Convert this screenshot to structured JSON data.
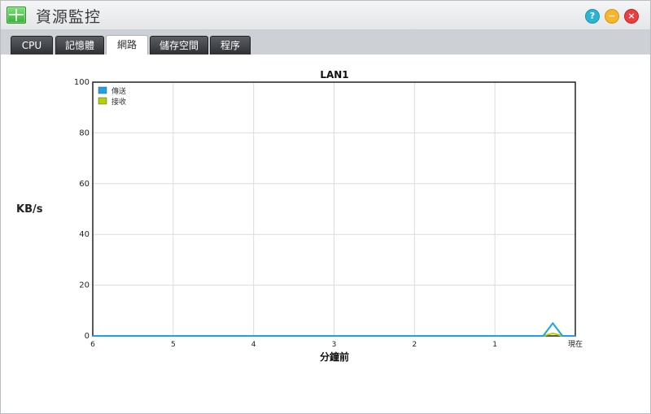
{
  "app": {
    "title": "資源監控",
    "window_buttons": {
      "help": "?",
      "minimize": "−",
      "close": "×"
    }
  },
  "tabs": [
    {
      "label": "CPU",
      "active": false
    },
    {
      "label": "記憶體",
      "active": false
    },
    {
      "label": "網路",
      "active": true
    },
    {
      "label": "儲存空間",
      "active": false
    },
    {
      "label": "程序",
      "active": false
    }
  ],
  "chart_data": {
    "type": "line",
    "title": "LAN1",
    "xlabel": "分鐘前",
    "ylabel": "KB/s",
    "x_ticks": [
      "6",
      "5",
      "4",
      "3",
      "2",
      "1",
      "現在"
    ],
    "y_ticks": [
      "0",
      "20",
      "40",
      "60",
      "80",
      "100"
    ],
    "ylim": [
      0,
      100
    ],
    "xlim": [
      6,
      0
    ],
    "grid": true,
    "legend_position": "top-left",
    "series": [
      {
        "name": "傳送",
        "color": "#1aa3e8",
        "x": [
          6,
          5,
          4,
          3,
          2,
          1,
          0.4,
          0.28,
          0.16,
          0
        ],
        "y": [
          0,
          0,
          0,
          0,
          0,
          0,
          0,
          5,
          0,
          0
        ]
      },
      {
        "name": "接收",
        "color": "#b5cf00",
        "x": [
          6,
          5,
          4,
          3,
          2,
          1,
          0.4,
          0.28,
          0.16,
          0
        ],
        "y": [
          0,
          0,
          0,
          0,
          0,
          0,
          0,
          1,
          0,
          0
        ]
      }
    ]
  }
}
